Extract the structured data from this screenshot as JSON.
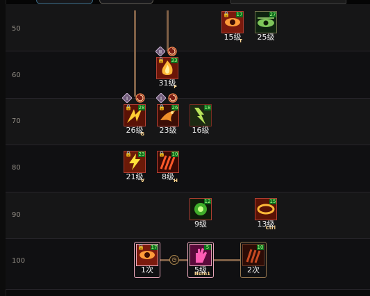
{
  "top_bar": {
    "right_tab_text": "??? ??? · ??? ?????"
  },
  "level_rows": [
    {
      "level": "50"
    },
    {
      "level": "60"
    },
    {
      "level": "70"
    },
    {
      "level": "80"
    },
    {
      "level": "90"
    },
    {
      "level": "100"
    }
  ],
  "skills": {
    "s50a": {
      "label": "15级",
      "count": "17",
      "hotkey": "T",
      "icon": "eye-icon"
    },
    "s50b": {
      "label": "25级",
      "count": "27",
      "hotkey": "",
      "icon": "green-eye-icon"
    },
    "s60": {
      "label": "31级",
      "count": "33",
      "hotkey": "F",
      "icon": "flame-burst-icon"
    },
    "s70a": {
      "label": "26级",
      "count": "28",
      "hotkey": "G",
      "icon": "fire-slash-icon"
    },
    "s70b": {
      "label": "23级",
      "count": "26",
      "hotkey": "",
      "icon": "fire-bird-icon"
    },
    "s70c": {
      "label": "16级",
      "count": "18",
      "hotkey": "",
      "icon": "lightning-claw-icon"
    },
    "s80a": {
      "label": "21级",
      "count": "23",
      "hotkey": "V",
      "icon": "lightning-bolt-icon"
    },
    "s80b": {
      "label": "8级",
      "count": "10",
      "hotkey": "H",
      "icon": "red-claw-icon"
    },
    "s90a": {
      "label": "9级",
      "count": "12",
      "hotkey": "",
      "icon": "green-orb-icon"
    },
    "s90b": {
      "label": "13级",
      "count": "15",
      "hotkey": "Ctrl",
      "icon": "fire-ring-icon"
    },
    "s100a": {
      "label": "1次",
      "count": "17",
      "hotkey": "",
      "icon": "eye-icon"
    },
    "s100b": {
      "label": "5级",
      "count": "5",
      "hotkey": "Num1",
      "icon": "pink-hand-icon"
    },
    "s100c": {
      "label": "2次",
      "count": "10",
      "hotkey": "",
      "icon": "dark-claw-icon"
    }
  },
  "prereq_tags": {
    "roman_a": "II",
    "roman_b": "I",
    "roman_c": "I"
  },
  "colors": {
    "frame_red": "#b23f32",
    "frame_pink": "#e7a6b9",
    "connector": "#7f6046",
    "count_bg": "#0f6e1d"
  }
}
